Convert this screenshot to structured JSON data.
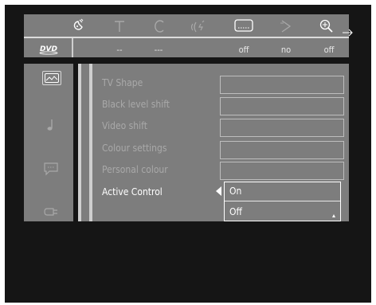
{
  "toolbar": {
    "icons": [
      "settings-icon",
      "text-icon",
      "copy-icon",
      "audio-icon",
      "subtitle-icon",
      "angle-icon",
      "zoom-icon"
    ],
    "values": [
      "--",
      "---",
      "off",
      "no",
      "off"
    ],
    "dvd_label": "DVD"
  },
  "sidebar": {
    "items": [
      "picture-icon",
      "music-note-icon",
      "speech-bubble-icon",
      "connector-icon"
    ]
  },
  "menu": {
    "items": [
      {
        "label": "TV Shape"
      },
      {
        "label": "Black level shift"
      },
      {
        "label": "Video shift"
      },
      {
        "label": "Colour settings"
      },
      {
        "label": "Personal colour"
      },
      {
        "label": "Active Control"
      }
    ],
    "dropdown": {
      "options": [
        "On",
        "Off"
      ]
    }
  }
}
